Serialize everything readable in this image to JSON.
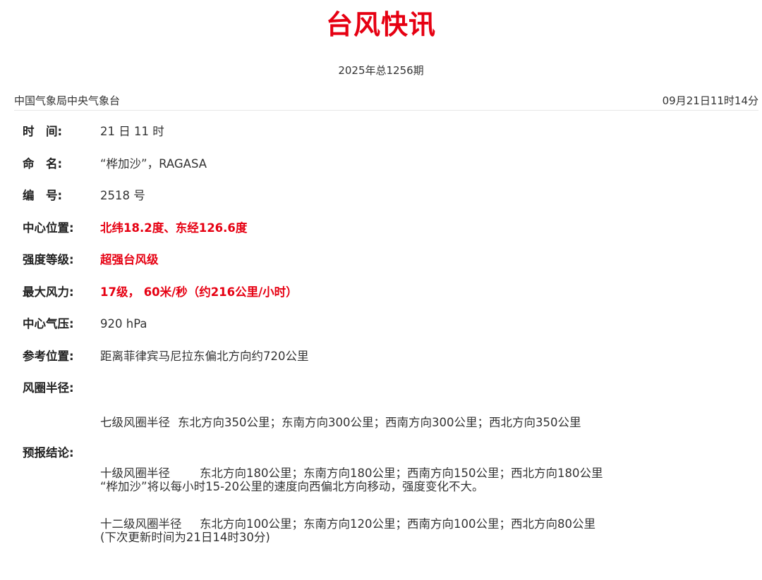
{
  "header": {
    "title": "台风快讯",
    "issue": "2025年总1256期",
    "agency": "中国气象局中央气象台",
    "datetime": "09月21日11时14分"
  },
  "fields": [
    {
      "label": "时　间:",
      "value": "21 日 11 时"
    },
    {
      "label": "命　名:",
      "value": "“桦加沙”，RAGASA"
    },
    {
      "label": "编　号:",
      "value": "2518 号"
    },
    {
      "label": "中心位置:",
      "value": "北纬18.2度、东经126.6度"
    },
    {
      "label": "强度等级:",
      "value": "超强台风级"
    },
    {
      "label": "最大风力:",
      "value": "17级， 60米/秒（约216公里/小时）"
    },
    {
      "label": "中心气压:",
      "value": "920 hPa"
    },
    {
      "label": "参考位置:",
      "value": "距离菲律宾马尼拉东偏北方向约720公里"
    }
  ],
  "wind_radius": {
    "label": "风圈半径:",
    "lines": [
      {
        "level": "七级风圈半径",
        "detail": "东北方向350公里；东南方向300公里；西南方向300公里；西北方向350公里"
      },
      {
        "level": "十级风圈半径",
        "detail": "东北方向180公里；东南方向180公里；西南方向150公里；西北方向180公里"
      },
      {
        "level": "十二级风圈半径",
        "detail": "东北方向100公里；东南方向120公里；西南方向100公里；西北方向80公里"
      }
    ]
  },
  "forecast": {
    "label": "预报结论:",
    "text": "“桦加沙”将以每小时15-20公里的速度向西偏北方向移动，强度变化不大。",
    "next_update": "(下次更新时间为21日14时30分)"
  },
  "colors": {
    "title": "#e60012",
    "highlight": "#e60012",
    "text": "#333333"
  }
}
